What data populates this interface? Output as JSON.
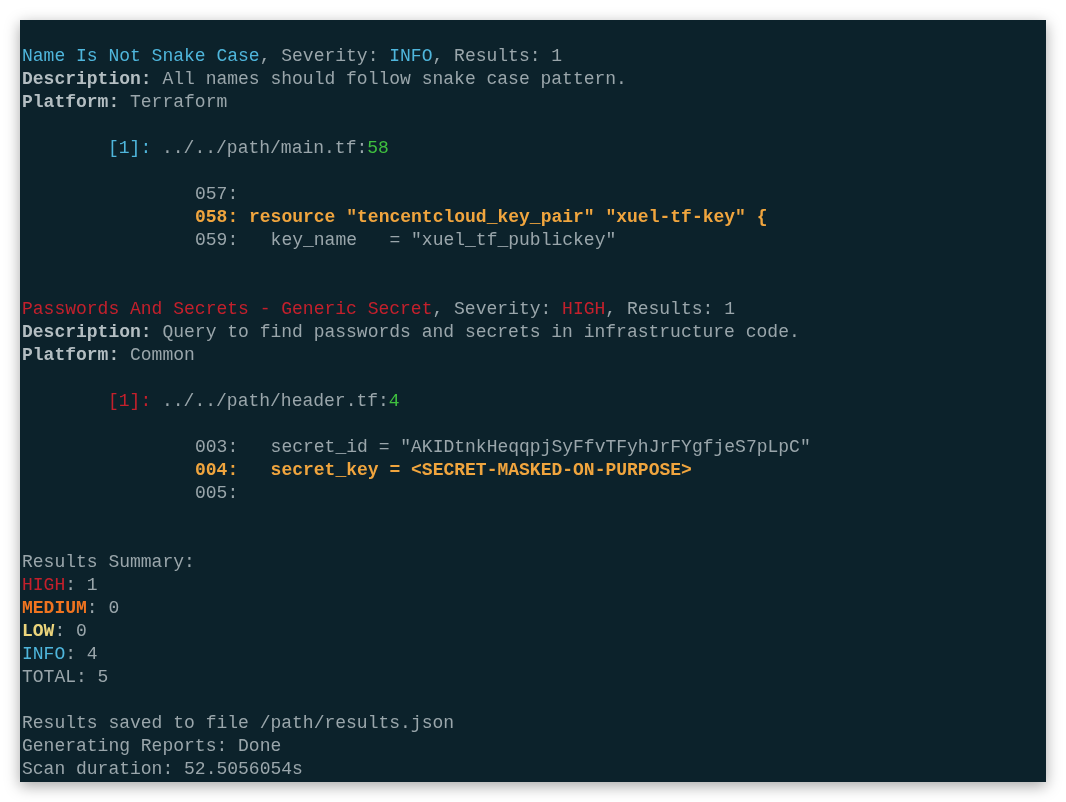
{
  "terminal": {
    "blocks": [
      {
        "kind": "header",
        "lines": [
          [
            {
              "text": "Name Is Not Snake Case",
              "kind": "info"
            },
            {
              "text": ", Severity: ",
              "kind": "plain"
            },
            {
              "text": "INFO",
              "kind": "info"
            },
            {
              "text": ", Results: 1",
              "kind": "plain"
            }
          ],
          [
            {
              "text": "Description:",
              "kind": "bold"
            },
            {
              "text": " All names should follow snake case pattern.",
              "kind": "plain"
            }
          ],
          [
            {
              "text": "Platform:",
              "kind": "bold"
            },
            {
              "text": " Terraform",
              "kind": "plain"
            }
          ]
        ]
      },
      {
        "kind": "location",
        "lines": [
          [
            {
              "text": "[1]:",
              "kind": "info"
            },
            {
              "text": " ../../path/main.tf:",
              "kind": "plain"
            },
            {
              "text": "58",
              "kind": "green"
            }
          ]
        ]
      },
      {
        "kind": "code",
        "lines": [
          [
            {
              "text": "057:",
              "kind": "plain"
            }
          ],
          [
            {
              "text": "058: resource \"tencentcloud_key_pair\" \"xuel-tf-key\" {",
              "kind": "highlight"
            }
          ],
          [
            {
              "text": "059:   key_name   = \"xuel_tf_publickey\"",
              "kind": "plain"
            }
          ]
        ]
      },
      {
        "kind": "header",
        "lines": [
          [
            {
              "text": "Passwords And Secrets - Generic Secret",
              "kind": "high"
            },
            {
              "text": ", Severity: ",
              "kind": "plain"
            },
            {
              "text": "HIGH",
              "kind": "high"
            },
            {
              "text": ", Results: 1",
              "kind": "plain"
            }
          ],
          [
            {
              "text": "Description:",
              "kind": "bold"
            },
            {
              "text": " Query to find passwords and secrets in infrastructure code.",
              "kind": "plain"
            }
          ],
          [
            {
              "text": "Platform:",
              "kind": "bold"
            },
            {
              "text": " Common",
              "kind": "plain"
            }
          ]
        ]
      },
      {
        "kind": "location",
        "lines": [
          [
            {
              "text": "[1]:",
              "kind": "high"
            },
            {
              "text": " ../../path/header.tf:",
              "kind": "plain"
            },
            {
              "text": "4",
              "kind": "green"
            }
          ]
        ]
      },
      {
        "kind": "code",
        "lines": [
          [
            {
              "text": "003:   secret_id = \"AKIDtnkHeqqpjSyFfvTFyhJrFYgfjeS7pLpC\"",
              "kind": "plain"
            }
          ],
          [
            {
              "text": "004:   secret_key = <SECRET-MASKED-ON-PURPOSE>",
              "kind": "highlight"
            }
          ],
          [
            {
              "text": "005:",
              "kind": "plain"
            }
          ]
        ]
      },
      {
        "kind": "summary",
        "lines": [
          [
            {
              "text": "Results Summary:",
              "kind": "plain"
            }
          ],
          [
            {
              "text": "HIGH",
              "kind": "high"
            },
            {
              "text": ": 1",
              "kind": "plain"
            }
          ],
          [
            {
              "text": "MEDIUM",
              "kind": "medium"
            },
            {
              "text": ": 0",
              "kind": "plain"
            }
          ],
          [
            {
              "text": "LOW",
              "kind": "low"
            },
            {
              "text": ": 0",
              "kind": "plain"
            }
          ],
          [
            {
              "text": "INFO",
              "kind": "info"
            },
            {
              "text": ": 4",
              "kind": "plain"
            }
          ],
          [
            {
              "text": "TOTAL: 5",
              "kind": "plain"
            }
          ]
        ]
      },
      {
        "kind": "footer",
        "lines": [
          [
            {
              "text": "Results saved to file /path/results.json",
              "kind": "plain"
            }
          ],
          [
            {
              "text": "Generating Reports: Done",
              "kind": "plain"
            }
          ],
          [
            {
              "text": "Scan duration: 52.5056054s",
              "kind": "plain"
            }
          ]
        ]
      }
    ]
  }
}
